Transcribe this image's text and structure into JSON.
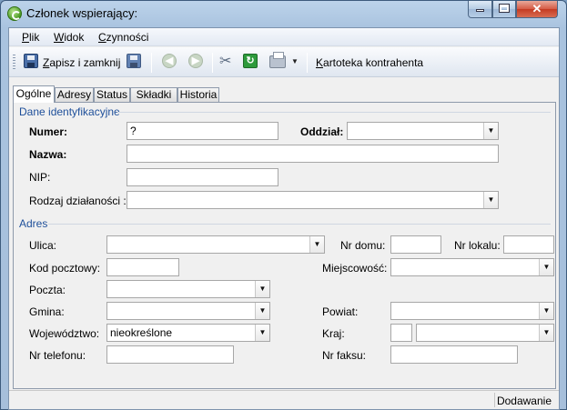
{
  "window": {
    "title": "Członek wspierający:",
    "min_icon": "minimize-icon",
    "max_icon": "maximize-icon",
    "close_glyph": "✕"
  },
  "menu": {
    "items": [
      {
        "accel": "P",
        "rest": "lik"
      },
      {
        "accel": "W",
        "rest": "idok"
      },
      {
        "accel": "C",
        "rest": "zynności"
      }
    ]
  },
  "toolbar": {
    "save_close_accel": "Z",
    "save_close_rest": "apisz i zamknij",
    "card_accel": "K",
    "card_rest": "artoteka kontrahenta",
    "back_glyph": "◀",
    "forward_glyph": "▶",
    "tools_glyph": "✂",
    "refresh_glyph": "↻",
    "dropdown_glyph": "▼"
  },
  "tabs": [
    "Ogólne",
    "Adresy",
    "Status",
    "Składki",
    "Historia"
  ],
  "sections": {
    "identification": "Dane identyfikacyjne",
    "address": "Adres"
  },
  "fields": {
    "numer": {
      "label": "Numer:",
      "value": "?"
    },
    "oddzial": {
      "label": "Oddział:",
      "value": ""
    },
    "nazwa": {
      "label": "Nazwa:",
      "value": ""
    },
    "nip": {
      "label": "NIP:",
      "value": ""
    },
    "rodzaj": {
      "label": "Rodzaj działaności :",
      "value": ""
    },
    "ulica": {
      "label": "Ulica:",
      "value": ""
    },
    "nr_domu": {
      "label": "Nr domu:",
      "value": ""
    },
    "nr_lokalu": {
      "label": "Nr lokalu:",
      "value": ""
    },
    "kod": {
      "label": "Kod pocztowy:",
      "value": ""
    },
    "miejscowosc": {
      "label": "Miejscowość:",
      "value": ""
    },
    "poczta": {
      "label": "Poczta:",
      "value": ""
    },
    "gmina": {
      "label": "Gmina:",
      "value": ""
    },
    "powiat": {
      "label": "Powiat:",
      "value": ""
    },
    "wojewodztwo": {
      "label": "Województwo:",
      "value": "nieokreślone"
    },
    "kraj": {
      "label": "Kraj:",
      "code": "",
      "value": ""
    },
    "telefon": {
      "label": "Nr telefonu:",
      "value": ""
    },
    "faks": {
      "label": "Nr faksu:",
      "value": ""
    }
  },
  "combo_arrow": "▼",
  "status": {
    "mode": "Dodawanie"
  }
}
